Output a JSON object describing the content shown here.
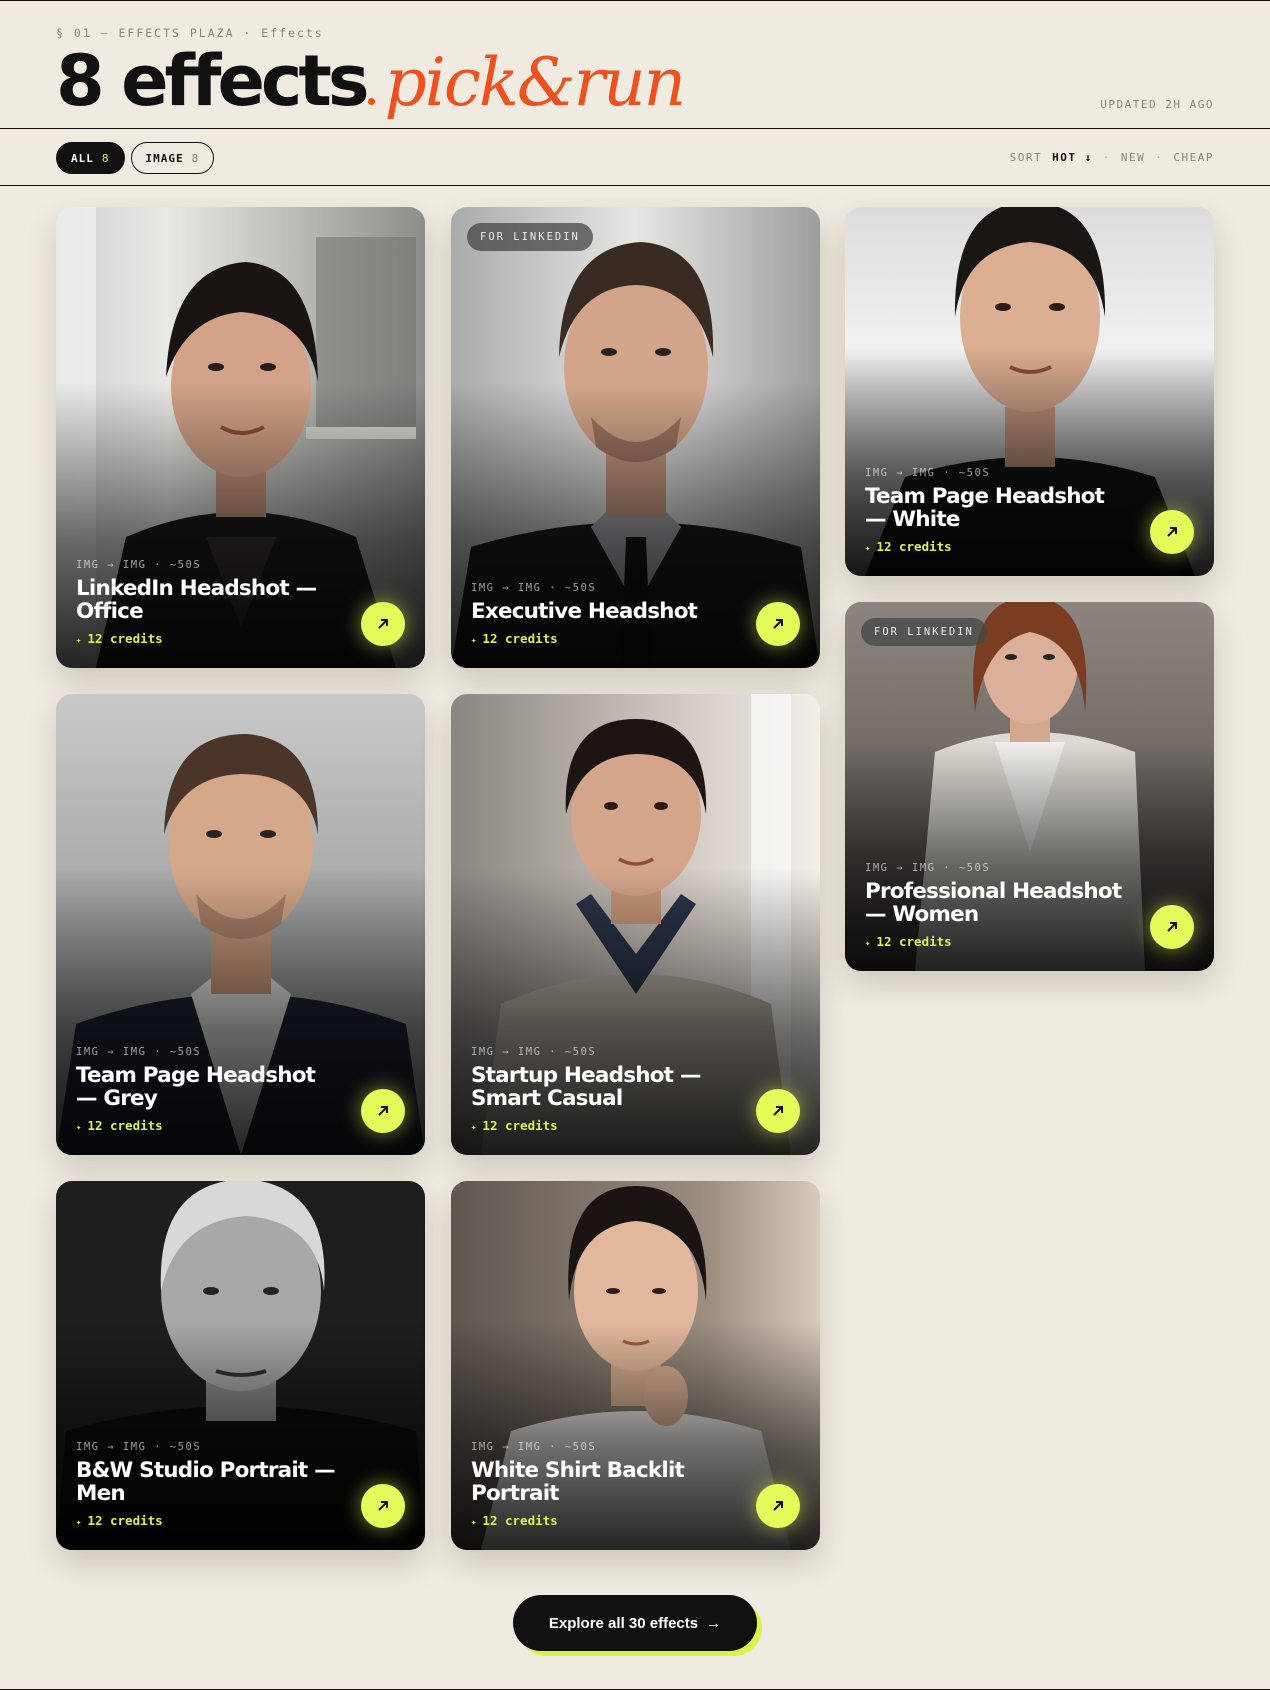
{
  "header": {
    "section": "§ 01",
    "breadcrumb": "— EFFECTS PLAZA · Effects",
    "title_main": "8 effects",
    "title_accent": "pick&run",
    "updated": "UPDATED 2H AGO"
  },
  "filters": [
    {
      "label": "ALL",
      "count": "8",
      "active": true
    },
    {
      "label": "IMAGE",
      "count": "8",
      "active": false
    }
  ],
  "sort": {
    "label": "SORT",
    "options": [
      "HOT ↓",
      "NEW",
      "CHEAP"
    ],
    "selected": "HOT ↓"
  },
  "cards": [
    {
      "title": "LinkedIn Headshot — Office",
      "meta": "IMG → IMG · ~50S",
      "credits": "12 credits",
      "badge": ""
    },
    {
      "title": "Executive Headshot",
      "meta": "IMG → IMG · ~50S",
      "credits": "12 credits",
      "badge": "FOR LINKEDIN"
    },
    {
      "title": "Team Page Headshot — White",
      "meta": "IMG → IMG · ~50S",
      "credits": "12 credits",
      "badge": ""
    },
    {
      "title": "Team Page Headshot — Grey",
      "meta": "IMG → IMG · ~50S",
      "credits": "12 credits",
      "badge": ""
    },
    {
      "title": "Startup Headshot — Smart Casual",
      "meta": "IMG → IMG · ~50S",
      "credits": "12 credits",
      "badge": ""
    },
    {
      "title": "Professional Headshot — Women",
      "meta": "IMG → IMG · ~50S",
      "credits": "12 credits",
      "badge": "FOR LINKEDIN"
    },
    {
      "title": "B&W Studio Portrait — Men",
      "meta": "IMG → IMG · ~50S",
      "credits": "12 credits",
      "badge": ""
    },
    {
      "title": "White Shirt Backlit Portrait",
      "meta": "IMG → IMG · ~50S",
      "credits": "12 credits",
      "badge": ""
    }
  ],
  "cta": {
    "label": "Explore all 30 effects",
    "arrow": "→"
  },
  "colors": {
    "accent": "#f0501e",
    "lime": "#e4fb5a",
    "background": "#efebe0",
    "ink": "#111111"
  }
}
